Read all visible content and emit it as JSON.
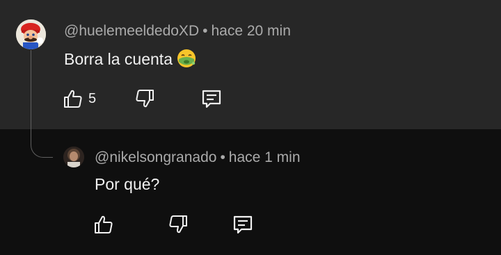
{
  "comments": [
    {
      "author": "@huelemeeldedoXD",
      "separator": "•",
      "time": "hace 20 min",
      "text": "Borra la cuenta",
      "emoji": "nauseated-face-icon",
      "like_count": "5"
    },
    {
      "author": "@nikelsongranado",
      "separator": "•",
      "time": "hace 1 min",
      "text": "Por qué?"
    }
  ],
  "colors": {
    "top_background": "#272727",
    "page_background": "#0f0f0f",
    "meta_text": "#aaaaaa",
    "body_text": "#f1f1f1",
    "emoji_green": "#6ab04c"
  }
}
